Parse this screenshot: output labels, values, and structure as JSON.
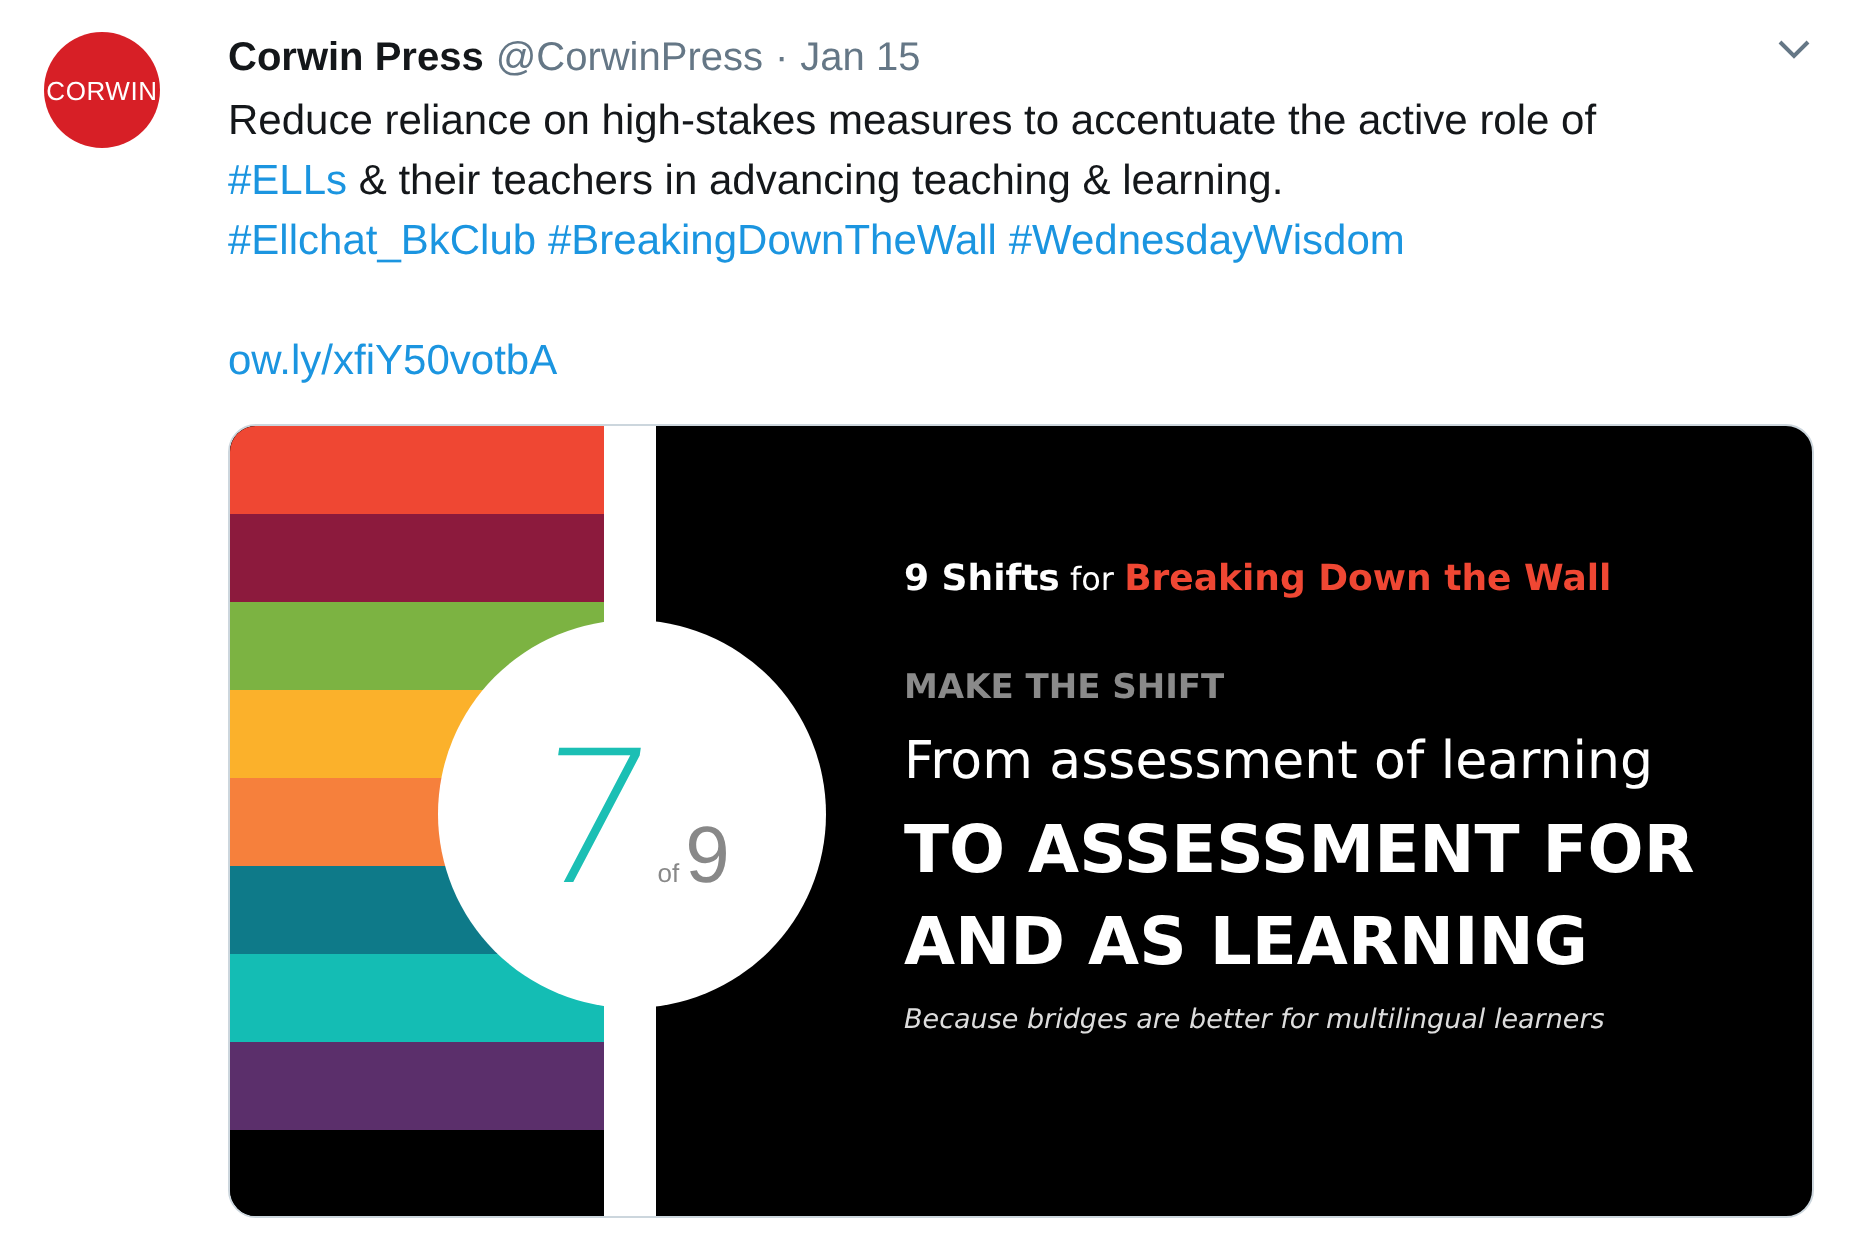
{
  "tweet": {
    "avatar_text": "CORWIN",
    "author": "Corwin Press",
    "handle": "@CorwinPress",
    "separator": "·",
    "date": "Jan 15",
    "blocks": [
      {
        "paragraphs": [
          {
            "segments": [
              {
                "kind": "plain",
                "text": "Reduce reliance on high-stakes measures to accentuate the active role of "
              },
              {
                "kind": "link",
                "text": "#ELLs"
              },
              {
                "kind": "plain",
                "text": " & their teachers in advancing teaching & learning."
              }
            ]
          },
          {
            "segments": [
              {
                "kind": "link",
                "text": "#Ellchat_BkClub"
              },
              {
                "kind": "link",
                "text": "#BreakingDownTheWall"
              },
              {
                "kind": "link",
                "text": "#WednesdayWisdom"
              }
            ]
          }
        ]
      },
      {
        "paragraphs": [
          {
            "segments": [
              {
                "kind": "link",
                "text": "ow.ly/xfiY50votbA"
              }
            ]
          }
        ]
      }
    ],
    "graphic": {
      "stripes": [
        {
          "color": "#ef4733"
        },
        {
          "color": "#8c1a3d"
        },
        {
          "color": "#7cb342"
        },
        {
          "color": "#fbb12b"
        },
        {
          "color": "#f6803c"
        },
        {
          "color": "#0e7a89"
        },
        {
          "color": "#14bdb4"
        },
        {
          "color": "#5b2f6b"
        }
      ],
      "badge": {
        "number": "7",
        "of": "of",
        "total": "9"
      },
      "heading": [
        {
          "kind": "bold",
          "text": "9 Shifts"
        },
        {
          "kind": "light",
          "text": " for "
        },
        {
          "kind": "accent",
          "text": "Breaking Down the Wall"
        }
      ],
      "kicker": "MAKE THE SHIFT",
      "from_line": "From assessment of learning",
      "to_line": "TO ASSESSMENT FOR AND AS LEARNING",
      "tagline": "Because bridges are better for multilingual learners"
    }
  }
}
